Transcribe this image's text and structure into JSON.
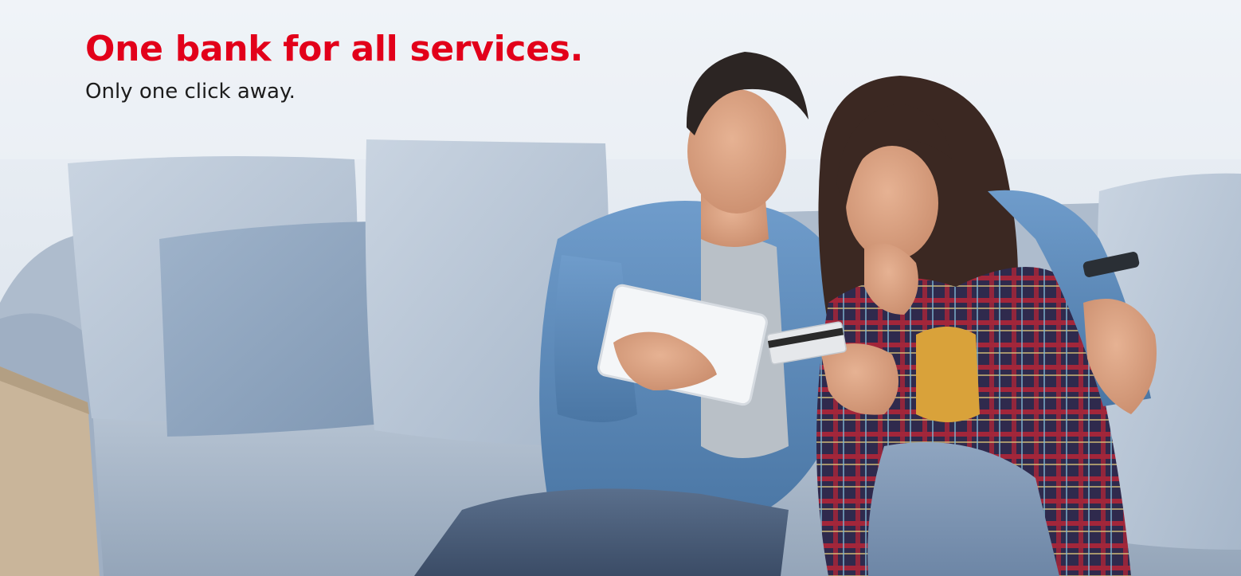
{
  "banner": {
    "headline": "One bank for all services.",
    "subline": "Only one click away.",
    "colors": {
      "headline": "#e2001a",
      "subline": "#1c1c1c",
      "wall": "#dfe6ee",
      "sofa": "#a9b8c9",
      "cushion_dark": "#8ea4bf",
      "denim_shirt": "#5f8fbf",
      "plaid_shirt": "#3a2f52"
    },
    "image_alt": "Couple on a sofa looking at a tablet while holding a payment card"
  }
}
